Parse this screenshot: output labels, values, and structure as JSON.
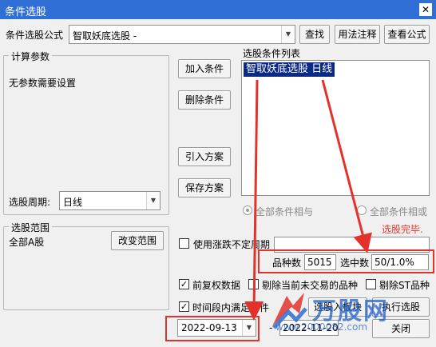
{
  "window": {
    "title": "条件选股",
    "close_glyph": "✕"
  },
  "formula": {
    "label": "条件选股公式",
    "selected": "智取妖底选股 -",
    "find_btn": "查找",
    "usage_btn": "用法注释",
    "view_btn": "查看公式"
  },
  "params": {
    "group_title": "计算参数",
    "no_params": "无参数需要设置",
    "period_label": "选股周期:",
    "period_value": "日线"
  },
  "actions": {
    "add": "加入条件",
    "delete": "删除条件",
    "import": "引入方案",
    "save": "保存方案"
  },
  "conditions": {
    "list_title": "选股条件列表",
    "items": [
      "智取妖底选股  日线"
    ],
    "radio_and": "全部条件相与",
    "radio_or": "全部条件相或"
  },
  "status": "选股完毕.",
  "range": {
    "group_title": "选股范围",
    "value": "全部A股",
    "change_btn": "改变范围"
  },
  "options": {
    "use_limit": "使用涨跌不定周期",
    "adjust": "前复权数据",
    "exclude_untraded": "剔除当前未交易的品种",
    "exclude_st": "剔除ST品种",
    "period_cond": "时间段内满足条件"
  },
  "stats": {
    "count_label": "品种数",
    "count_value": "5015",
    "selected_label": "选中数",
    "selected_value": "50/1.0%"
  },
  "buttons": {
    "to_block": "选股入板块",
    "run": "执行选股",
    "close": "关闭"
  },
  "dates": {
    "start": "2022-09-13",
    "dash": "-",
    "end": "2022-11-20"
  },
  "watermark": {
    "brand": "万股网",
    "site": "www.2000082.com"
  },
  "colors": {
    "titlebar": "#2f6fd6",
    "selection": "#0b2a87",
    "highlight": "#e2322b",
    "status": "#e03a2f"
  }
}
